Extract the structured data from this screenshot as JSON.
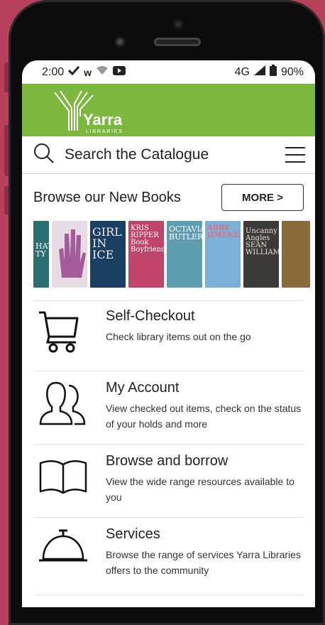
{
  "status": {
    "time": "2:00",
    "network": "4G",
    "battery": "90%"
  },
  "header": {
    "logo_name": "Yarra",
    "logo_sub": "LIBRARIES"
  },
  "search": {
    "label": "Search the Catalogue"
  },
  "browse": {
    "title": "Browse our New Books",
    "more_label": "MORE >"
  },
  "books": [
    {
      "cover_text": "HAT TY",
      "color": "#2a6f72"
    },
    {
      "cover_text": "",
      "color": "#e7dbe6"
    },
    {
      "cover_text": "GIRL IN ICE",
      "color": "#1b3f62"
    },
    {
      "cover_text": "KRIS RIPPER Book Boyfriend",
      "color": "#c1446a"
    },
    {
      "cover_text": "OCTAVIA BUTLER",
      "color": "#5e9db0"
    },
    {
      "cover_text": "ABBY JIMENEZ",
      "color": "#7bb0d9"
    },
    {
      "cover_text": "Uncanny Angles SEAN WILLIAMS",
      "color": "#3c3a36"
    },
    {
      "cover_text": "",
      "color": "#8a6b3b"
    }
  ],
  "menu": [
    {
      "title": "Self-Checkout",
      "desc": "Check library items out on the go",
      "icon": "cart-icon"
    },
    {
      "title": "My Account",
      "desc": "View checked out items, check on the status of your holds and more",
      "icon": "users-icon"
    },
    {
      "title": "Browse and borrow",
      "desc": "View the wide range resources available to you",
      "icon": "book-icon"
    },
    {
      "title": "Services",
      "desc": "Browse the range of services Yarra Libraries offers to the community",
      "icon": "bell-icon"
    }
  ]
}
